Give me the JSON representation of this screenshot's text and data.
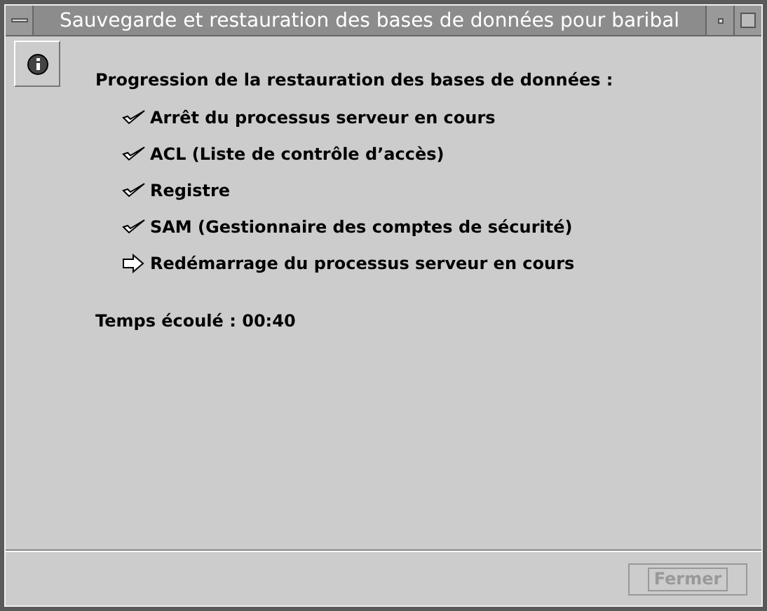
{
  "window": {
    "title": "Sauvegarde et restauration des bases de données pour baribal"
  },
  "heading": "Progression de la restauration des bases de données :",
  "steps": [
    {
      "label": "Arrêt du processus serveur en cours",
      "kind": "done"
    },
    {
      "label": "ACL (Liste de contrôle d’accès)",
      "kind": "done"
    },
    {
      "label": "Registre",
      "kind": "done"
    },
    {
      "label": "SAM (Gestionnaire des comptes de sécurité)",
      "kind": "done"
    },
    {
      "label": "Redémarrage du processus serveur en cours",
      "kind": "current"
    }
  ],
  "elapsed": "Temps écoulé : 00:40",
  "buttons": [
    {
      "label": "Fermer",
      "disabled": true
    }
  ]
}
